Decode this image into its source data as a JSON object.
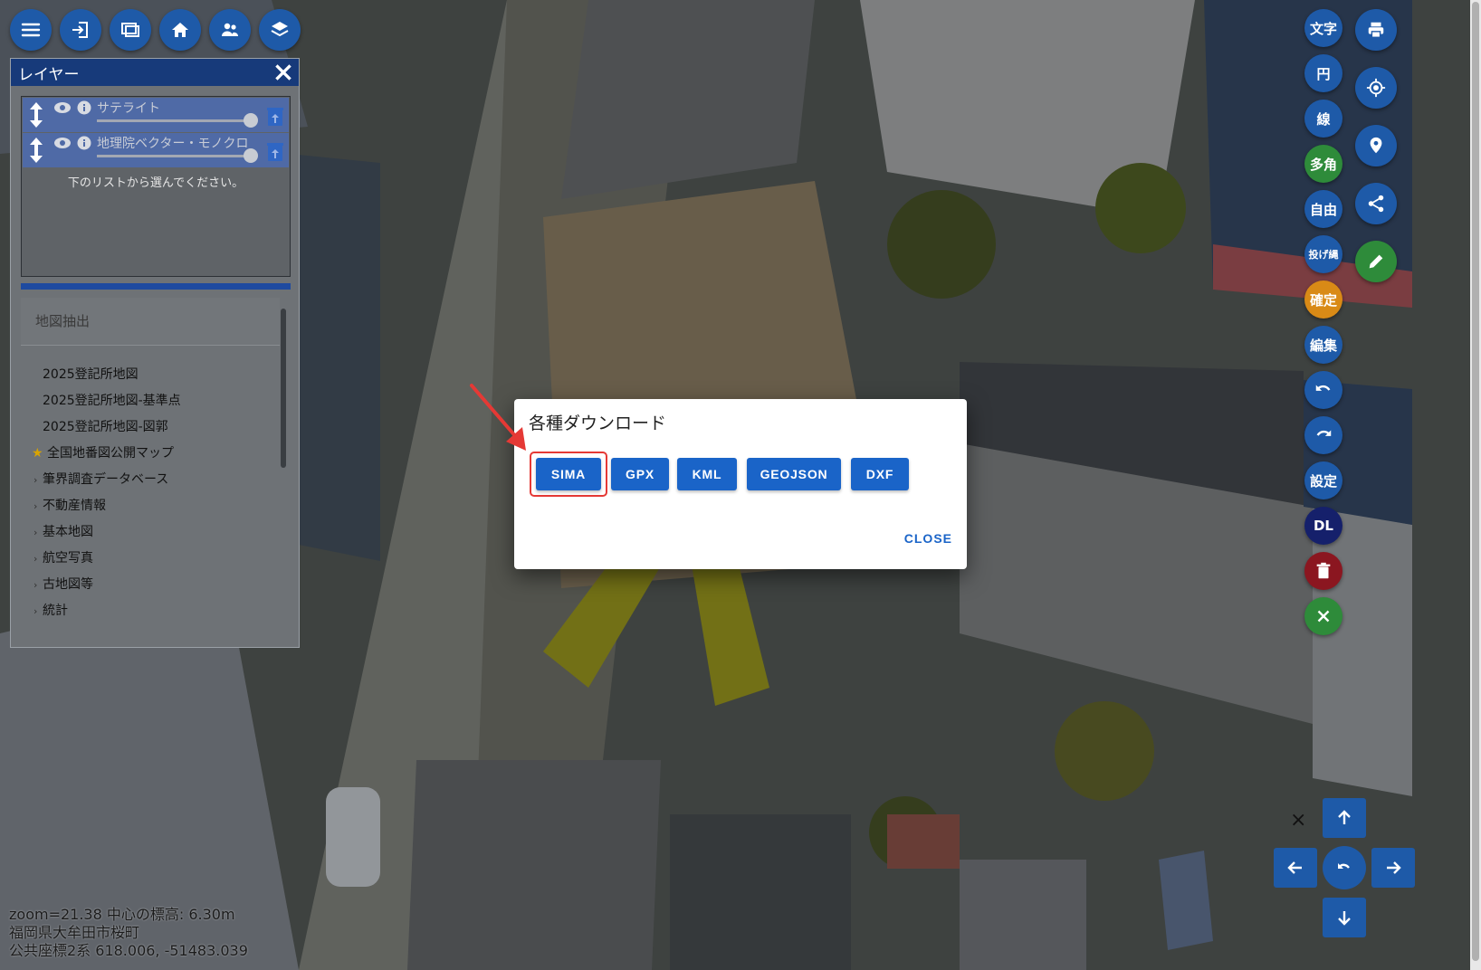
{
  "toolbar": {
    "icons": [
      "menu-icon",
      "login-icon",
      "display-icon",
      "home-icon",
      "users-icon",
      "layers-icon"
    ]
  },
  "layer_panel": {
    "title": "レイヤー",
    "layers": [
      {
        "name": "サテライト"
      },
      {
        "name": "地理院ベクター・モノクロ"
      }
    ],
    "hint": "下のリストから選んでください。",
    "section_title": "地図抽出",
    "items": [
      "2025登記所地図",
      "2025登記所地図-基準点",
      "2025登記所地図-図郭",
      "全国地番図公開マップ"
    ],
    "groups": [
      "筆界調査データベース",
      "不動産情報",
      "基本地図",
      "航空写真",
      "古地図等",
      "統計"
    ]
  },
  "right_tools": {
    "text": "文字",
    "circle": "円",
    "line": "線",
    "polygon": "多角",
    "free": "自由",
    "lasso": "投げ縄",
    "confirm": "確定",
    "edit": "編集",
    "settings": "設定",
    "download": "DL"
  },
  "right_icons": [
    "print-icon",
    "locate-icon",
    "pin-icon",
    "share-icon",
    "pencil-icon"
  ],
  "colors": {
    "tool_blue": "#1e5aa8",
    "tool_green": "#2e8b3a",
    "tool_orange": "#d98a16",
    "tool_navy": "#15206b",
    "tool_red": "#8b1620",
    "dialog_blue": "#1a64c8",
    "highlight_red": "#e53935"
  },
  "dialog": {
    "title": "各種ダウンロード",
    "buttons": [
      "SIMA",
      "GPX",
      "KML",
      "GEOJSON",
      "DXF"
    ],
    "close": "CLOSE"
  },
  "status": {
    "line1": "zoom=21.38 中心の標高: 6.30m",
    "line2": "福岡県大牟田市桜町",
    "line3": "公共座標2系 618.006, -51483.039"
  },
  "nav_close": "×"
}
